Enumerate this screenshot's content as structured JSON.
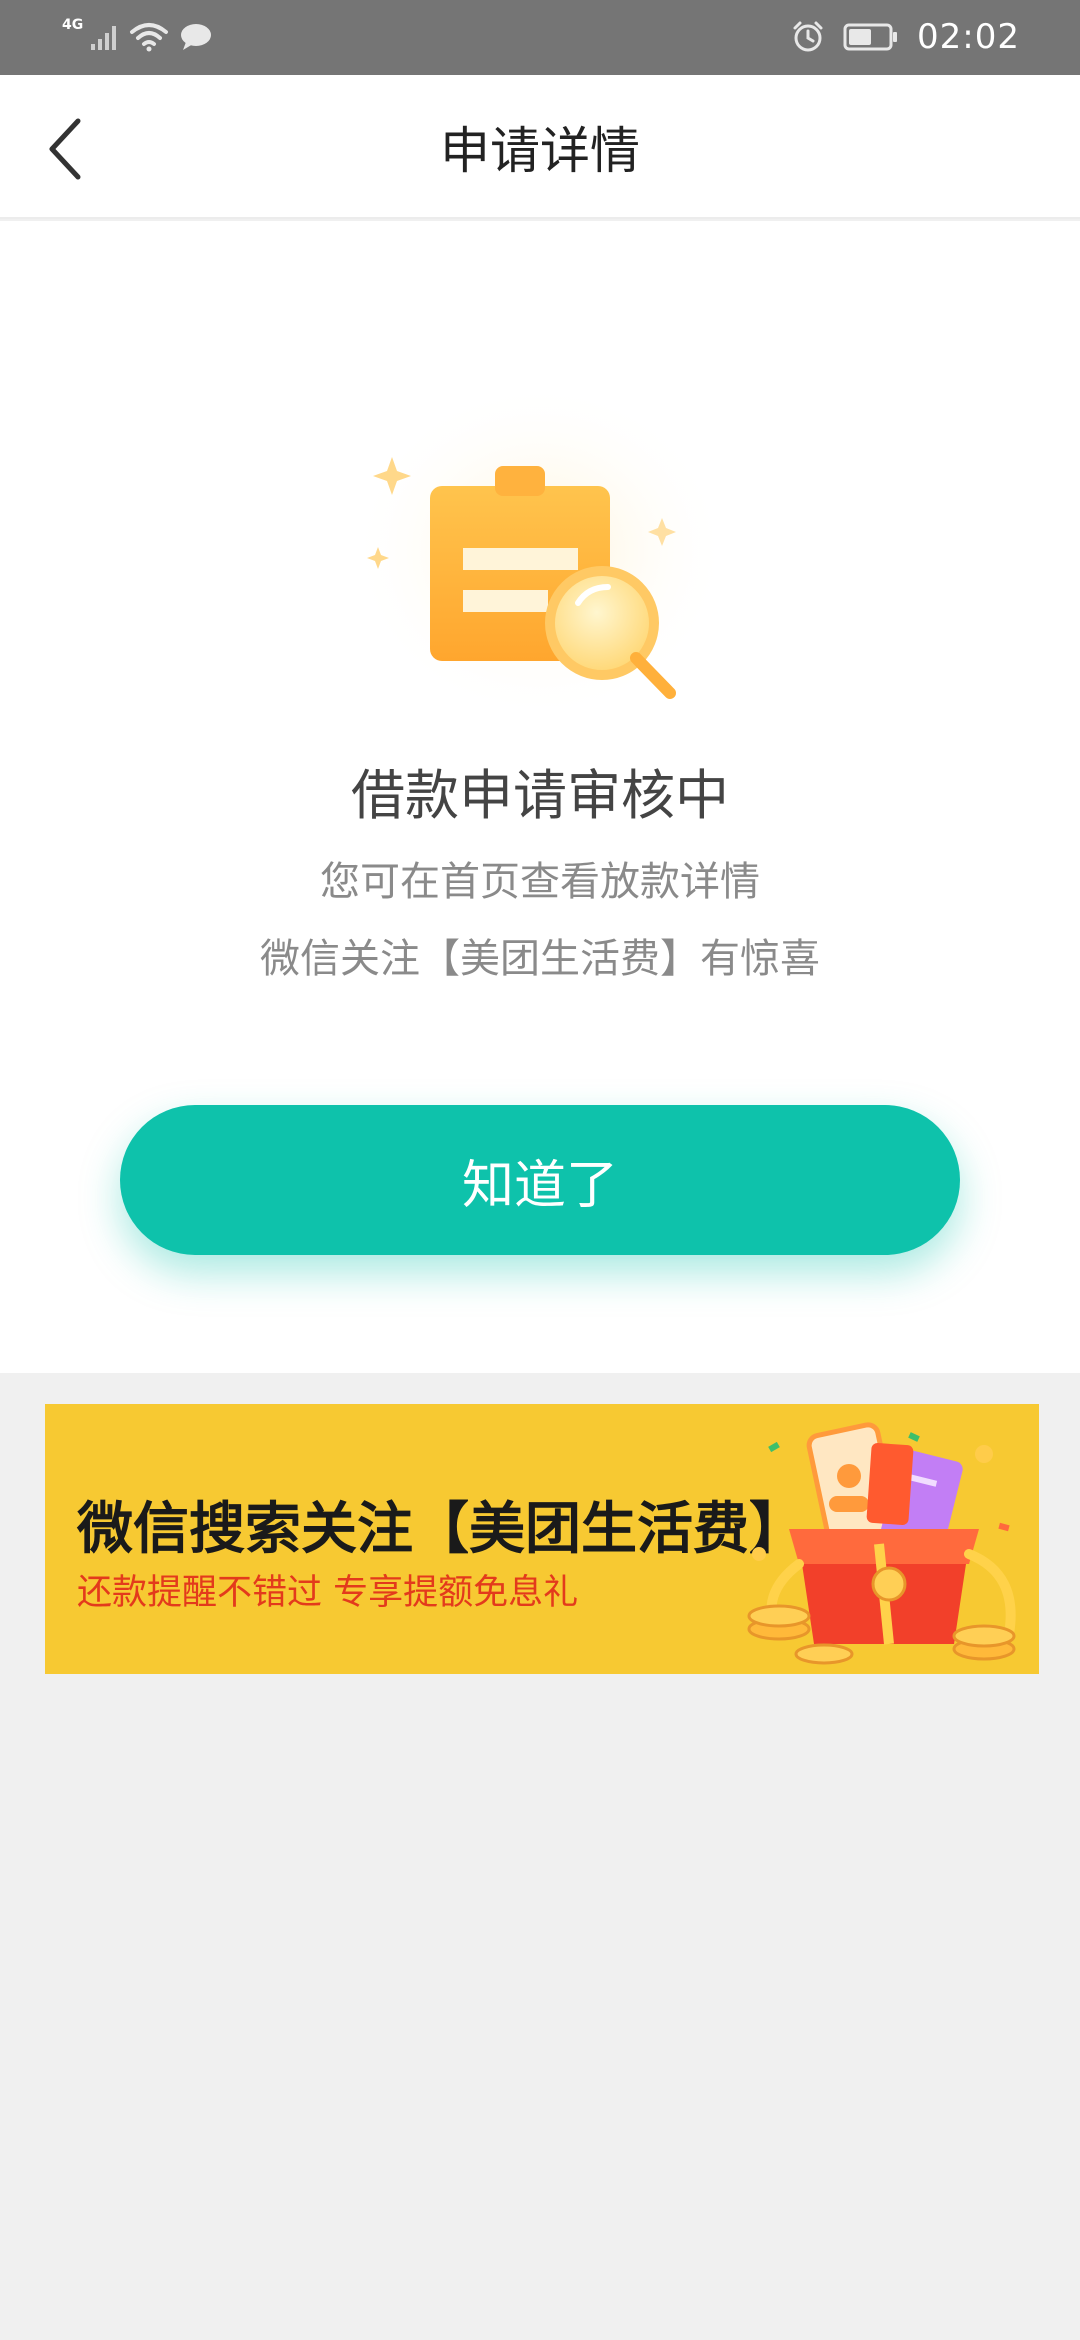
{
  "status_bar": {
    "network": "4G",
    "time": "02:02"
  },
  "nav": {
    "title": "申请详情"
  },
  "result": {
    "title": "借款申请审核中",
    "line1": "您可在首页查看放款详情",
    "line2": "微信关注【美团生活费】有惊喜",
    "button_label": "知道了"
  },
  "banner": {
    "title": "微信搜索关注【美团生活费】",
    "subtitle": "还款提醒不错过 专享提额免息礼"
  },
  "colors": {
    "accent": "#0ec2ab",
    "banner_bg": "#f7c932",
    "banner_subtitle": "#e33a1c",
    "status_bar": "#757575"
  }
}
